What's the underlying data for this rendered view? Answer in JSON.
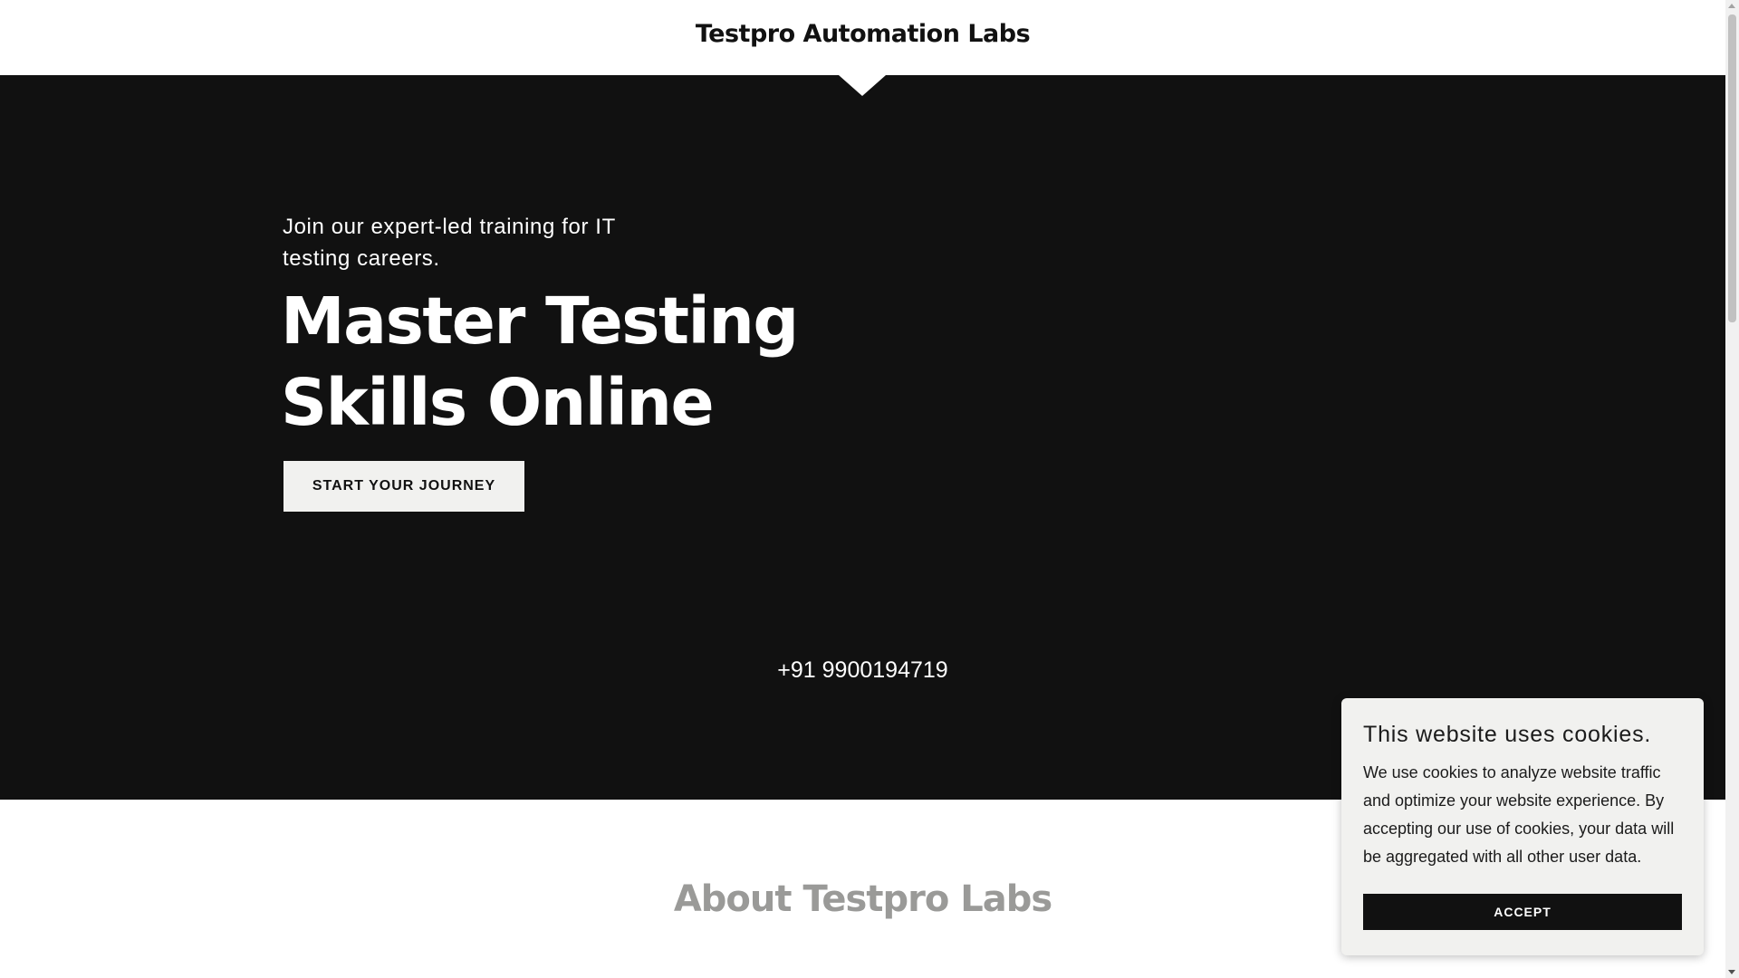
{
  "header": {
    "site_title": "Testpro Automation Labs"
  },
  "hero": {
    "tagline": "Join our expert-led training for IT testing careers.",
    "headline": "Master Testing Skills Online",
    "cta_label": "START YOUR JOURNEY",
    "phone": "+91 9900194719"
  },
  "about": {
    "title": "About Testpro Labs"
  },
  "cookie_banner": {
    "title": "This website uses cookies.",
    "body": "We use cookies to analyze website traffic and optimize your website experience. By accepting our use of cookies, your data will be aggregated with all other user data.",
    "accept_label": "ACCEPT"
  },
  "colors": {
    "hero_background": "#111111",
    "button_light": "#f1f1ef",
    "about_title": "#9a9a98"
  }
}
